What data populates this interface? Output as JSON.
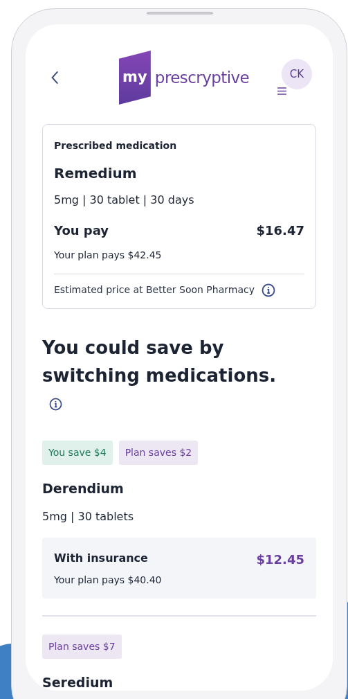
{
  "header": {
    "logo_mark": "my",
    "logo_word": "prescryptive",
    "avatar": "CK"
  },
  "prescribed": {
    "label": "Prescribed medication",
    "name": "Remedium",
    "details": "5mg | 30 tablet | 30 days",
    "pay_label": "You pay",
    "pay_amount": "$16.47",
    "plan_pays": "Your plan pays $42.45",
    "note": "Estimated price at Better Soon Pharmacy"
  },
  "savings_heading": "You could save by switching medications.",
  "alternatives": [
    {
      "tags": [
        {
          "kind": "member",
          "label": "You save $4"
        },
        {
          "kind": "plan",
          "label": "Plan saves $2"
        }
      ],
      "name": "Derendium",
      "details": "5mg | 30 tablets",
      "price": {
        "label": "With insurance",
        "amount": "$12.45",
        "plan_pays": "Your plan pays $40.40"
      }
    },
    {
      "tags": [
        {
          "kind": "plan",
          "label": "Plan saves $7"
        }
      ],
      "name": "Seredium"
    }
  ]
}
